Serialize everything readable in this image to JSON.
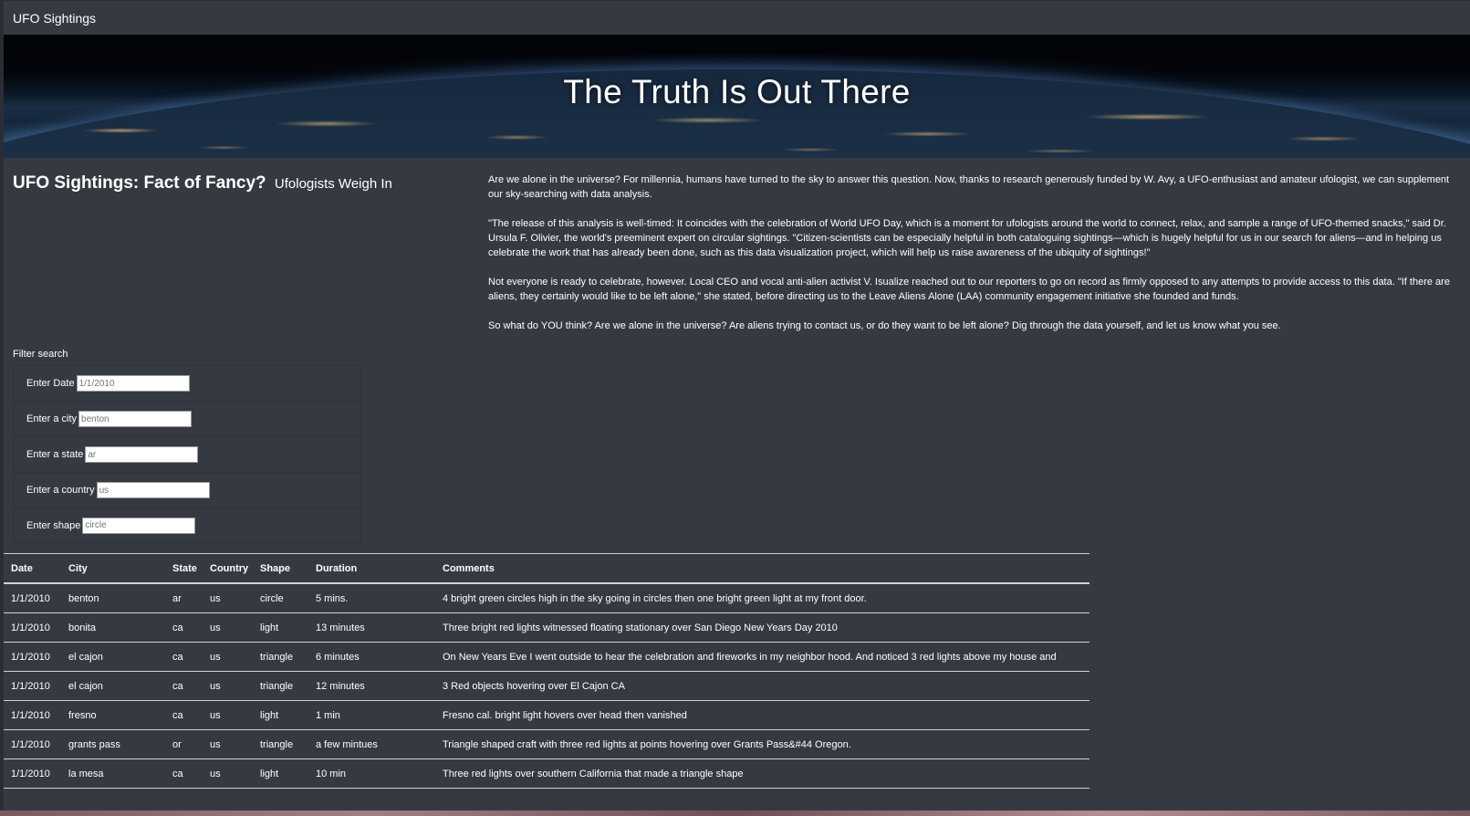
{
  "navbar": {
    "brand": "UFO Sightings"
  },
  "hero": {
    "title": "The Truth Is Out There"
  },
  "article": {
    "heading": "UFO Sightings: Fact of Fancy?",
    "subheading": "Ufologists Weigh In",
    "paragraphs": [
      "Are we alone in the universe? For millennia, humans have turned to the sky to answer this question. Now, thanks to research generously funded by W. Avy, a UFO-enthusiast and amateur ufologist, we can supplement our sky-searching with data analysis.",
      "\"The release of this analysis is well-timed: It coincides with the celebration of World UFO Day, which is a moment for ufologists around the world to connect, relax, and sample a range of UFO-themed snacks,\" said Dr. Ursula F. Olivier, the world's preeminent expert on circular sightings. \"Citizen-scientists can be especially helpful in both cataloguing sightings—which is hugely helpful for us in our search for aliens—and in helping us celebrate the work that has already been done, such as this data visualization project, which will help us raise awareness of the ubiquity of sightings!\"",
      "Not everyone is ready to celebrate, however. Local CEO and vocal anti-alien activist V. Isualize reached out to our reporters to go on record as firmly opposed to any attempts to provide access to this data. \"If there are aliens, they certainly would like to be left alone,\" she stated, before directing us to the Leave Aliens Alone (LAA) community engagement initiative she founded and funds.",
      "So what do YOU think? Are we alone in the universe? Are aliens trying to contact us, or do they want to be left alone? Dig through the data yourself, and let us know what you see."
    ]
  },
  "filters": {
    "title": "Filter search",
    "items": [
      {
        "label": "Enter Date",
        "placeholder": "1/1/2010"
      },
      {
        "label": "Enter a city",
        "placeholder": "benton"
      },
      {
        "label": "Enter a state",
        "placeholder": "ar"
      },
      {
        "label": "Enter a country",
        "placeholder": "us"
      },
      {
        "label": "Enter shape",
        "placeholder": "circle"
      }
    ]
  },
  "table": {
    "headers": [
      "Date",
      "City",
      "State",
      "Country",
      "Shape",
      "Duration",
      "Comments"
    ],
    "rows": [
      [
        "1/1/2010",
        "benton",
        "ar",
        "us",
        "circle",
        "5 mins.",
        "4 bright green circles high in the sky going in circles then one bright green light at my front door."
      ],
      [
        "1/1/2010",
        "bonita",
        "ca",
        "us",
        "light",
        "13 minutes",
        "Three bright red lights witnessed floating stationary over San Diego New Years Day 2010"
      ],
      [
        "1/1/2010",
        "el cajon",
        "ca",
        "us",
        "triangle",
        "6 minutes",
        "On New Years Eve I went outside to hear the celebration and fireworks in my neighbor hood. And noticed 3 red lights above my house and"
      ],
      [
        "1/1/2010",
        "el cajon",
        "ca",
        "us",
        "triangle",
        "12 minutes",
        "3 Red objects hovering over El Cajon CA"
      ],
      [
        "1/1/2010",
        "fresno",
        "ca",
        "us",
        "light",
        "1 min",
        "Fresno cal. bright light hovers over head then vanished"
      ],
      [
        "1/1/2010",
        "grants pass",
        "or",
        "us",
        "triangle",
        "a few mintues",
        "Triangle shaped craft with three red lights at points hovering over Grants Pass&#44 Oregon."
      ],
      [
        "1/1/2010",
        "la mesa",
        "ca",
        "us",
        "light",
        "10 min",
        "Three red lights over southern California that made a triangle shape"
      ]
    ]
  }
}
